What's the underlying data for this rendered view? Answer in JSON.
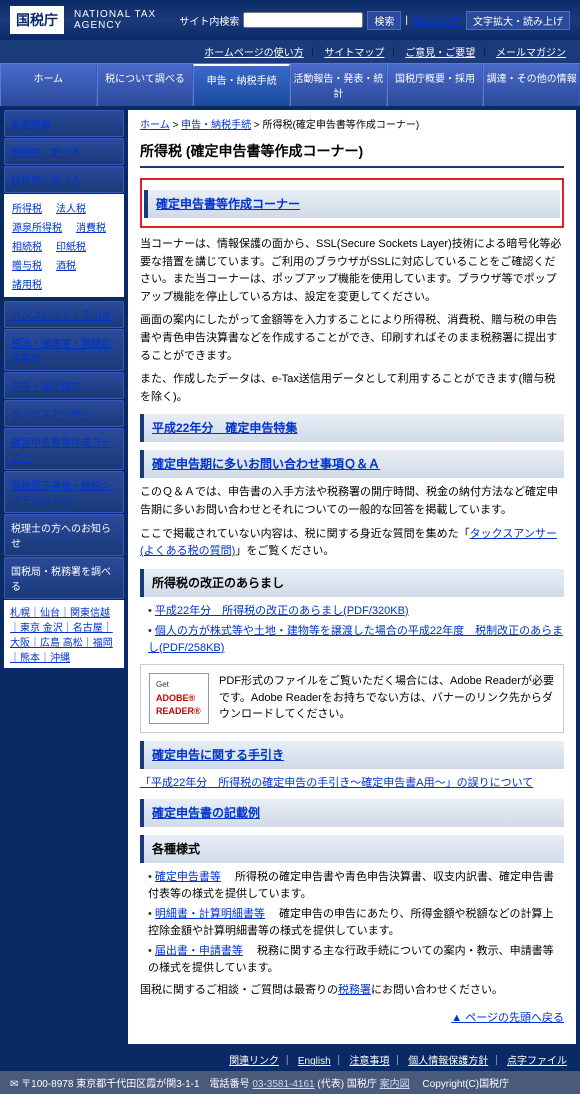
{
  "header": {
    "logo": "国税庁",
    "agency_en": "NATIONAL TAX AGENCY",
    "search_label": "サイト内検索",
    "search_button": "検索",
    "search_help": "検索の仕方",
    "zoom": "文字拡大・読み上げ",
    "links": {
      "usage": "ホームページの使い方",
      "sitemap": "サイトマップ",
      "feedback": "ご意見・ご要望",
      "mail": "メールマガジン"
    }
  },
  "nav": {
    "home": "ホーム",
    "tax_info": "税について調べる",
    "filing": "申告・納税手続",
    "activity": "活動報告・発表・統計",
    "recruit": "国税庁概要・採用",
    "other": "調達・その他の情報"
  },
  "sidebar": {
    "news": "新着情報",
    "by_period": "時期別に調べる",
    "by_tax": "税目別に調べる",
    "taxes": {
      "income": "所得税",
      "corp": "法人税",
      "gensen": "源泉所得税",
      "shohi": "消費税",
      "sozoku": "相続税",
      "inshi": "印紙税",
      "zoyo": "贈与税",
      "sake": "酒税",
      "shouyo": "諸用税"
    },
    "pamphlet": "パンフレット・手引き",
    "law": "税法・通達等・質疑応答事例",
    "filing_due": "申告・届出様式",
    "tax_answer": "タックスアンサー",
    "corner": "確定申告書等作成コーナー",
    "etax": "国税電子申告・納税システム(e-Tax)",
    "advisor": "税理士の方へのお知らせ",
    "local": "国税局・税務署を調べる",
    "regions": "札幌｜仙台｜関東信越｜東京 金沢｜名古屋｜大阪｜広島 高松｜福岡｜熊本｜沖縄"
  },
  "content": {
    "breadcrumb_home": "ホーム",
    "breadcrumb_filing": "申告・納税手続",
    "breadcrumb_current": "所得税(確定申告書等作成コーナー)",
    "title": "所得税 (確定申告書等作成コーナー)",
    "corner_title": "確定申告書等作成コーナー",
    "intro1": "当コーナーは、情報保護の面から、SSL(Secure Sockets Layer)技術による暗号化等必要な措置を講じています。ご利用のブラウザがSSLに対応していることをご確認ください。また当コーナーは、ポップアップ機能を使用しています。ブラウザ等でポップアップ機能を停止している方は、設定を変更してください。",
    "intro2": "画面の案内にしたがって金額等を入力することにより所得税、消費税、贈与税の申告書や青色申告決算書などを作成することができ、印刷すればそのまま税務署に提出することができます。",
    "intro3": "また、作成したデータは、e-Tax送信用データとして利用することができます(贈与税を除く)。",
    "h22_special": "平成22年分　確定申告特集",
    "qa_title": "確定申告期に多いお問い合わせ事項Ｑ＆Ａ",
    "qa_text": "このＱ＆Ａでは、申告書の入手方法や税務署の開庁時間、税金の納付方法など確定申告期に多いお問い合わせとそれについての一般的な回答を掲載しています。",
    "qa_text2_pre": "ここで掲載されていない内容は、税に関する身近な質問を集めた「",
    "qa_link": "タックスアンサー(よくある税の質問)",
    "qa_text2_post": "」をご覧ください。",
    "revision_title": "所得税の改正のあらまし",
    "revision_link1": "平成22年分　所得税の改正のあらまし(PDF/320KB)",
    "revision_link2": "個人の方が株式等や土地・建物等を譲渡した場合の平成22年度　税制改正のあらまし(PDF/258KB)",
    "adobe_text": "PDF形式のファイルをご覧いただく場合には、Adobe Readerが必要です。Adobe Readerをお持ちでない方は、バナーのリンク先からダウンロードしてください。",
    "adobe_get": "Get",
    "adobe_reader": "ADOBE® READER®",
    "guide_title": "確定申告に関する手引き",
    "guide_link": "「平成22年分　所得税の確定申告の手引き～確定申告書A用～」の誤りについて",
    "example_title": "確定申告書の記載例",
    "forms_title": "各種様式",
    "forms1_link": "確定申告書等",
    "forms1_text": "所得税の確定申告書や青色申告決算書、収支内訳書、確定申告書付表等の様式を提供しています。",
    "forms2_link": "明細書・計算明細書等",
    "forms2_text": "確定申告の申告にあたり、所得金額や税額などの計算上控除金額や計算明細書等の様式を提供しています。",
    "forms3_link": "届出書・申請書等",
    "forms3_text": "税務に関する主な行政手続についての案内・教示、申請書等の様式を提供しています。",
    "consult_pre": "国税に関するご相談・ご質問は最寄りの",
    "consult_link": "税務署",
    "consult_post": "にお問い合わせください。",
    "to_top": "▲ ページの先頭へ戻る"
  },
  "footer": {
    "links": {
      "related": "関連リンク",
      "english": "English",
      "notice": "注意事項",
      "privacy": "個人情報保護方針",
      "score": "点字ファイル"
    },
    "address_pre": "〒100-8978 東京都千代田区霞が関3-1-1　電話番号",
    "tel": "03-3581-4161",
    "address_post": "(代表) 国税庁",
    "guide": "案内図",
    "copyright": "Copyright(C)国税庁"
  }
}
